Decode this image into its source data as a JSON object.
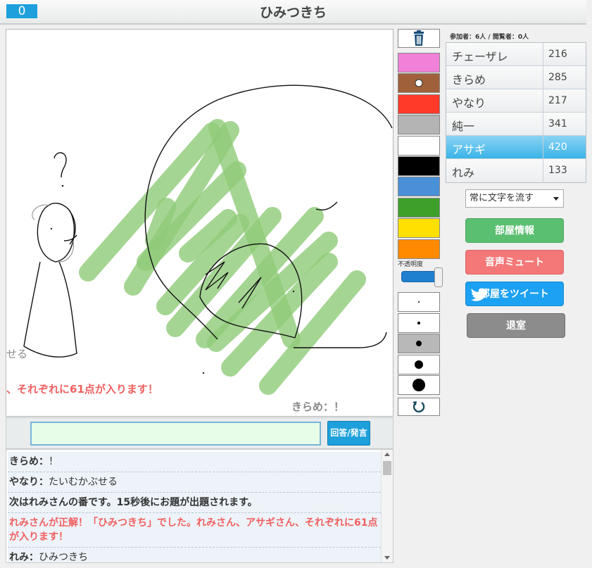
{
  "header": {
    "counter": "0",
    "title": "ひみつきち"
  },
  "canvas": {
    "partial_text_left": "せる",
    "partial_announcement": "、それぞれに61点が入ります！",
    "chat_bubble": "きらめ：！"
  },
  "answer": {
    "placeholder": "",
    "button_label": "回答/発言"
  },
  "chat": {
    "messages": [
      {
        "name": "きらめ",
        "sep": "：",
        "text": "！",
        "kind": "user"
      },
      {
        "name": "やなり",
        "sep": "：",
        "text": "たいむかぶせる",
        "kind": "user"
      },
      {
        "text": "次はれみさんの番です。15秒後にお題が出題されます。",
        "kind": "system"
      },
      {
        "text": "れみさんが正解！「ひみつきち」でした。れみさん、アサギさん、それぞれに61点が入ります！",
        "kind": "correct"
      },
      {
        "name": "れみ",
        "sep": "：",
        "text": "ひみつきち",
        "kind": "user"
      }
    ]
  },
  "tools": {
    "colors": [
      "#f080d8",
      "#a0603a",
      "#ff3a28",
      "#b4b4b4",
      "#ffffff",
      "#000000",
      "#4a90d8",
      "#3ea02a",
      "#ffe000",
      "#ff8a00"
    ],
    "selected_color_index": 1,
    "opacity_label": "不透明度",
    "opacity_value": 1.0,
    "brush_sizes": [
      2,
      4,
      8,
      12,
      18
    ],
    "selected_size_index": 2,
    "icons": {
      "trash": "trash-icon",
      "undo": "undo-icon"
    }
  },
  "room": {
    "participants": "参加者：6人 / 閲覧者：0人",
    "players": [
      {
        "name": "チェーザレ",
        "score": "216",
        "active": false
      },
      {
        "name": "きらめ",
        "score": "285",
        "active": false
      },
      {
        "name": "やなり",
        "score": "217",
        "active": false
      },
      {
        "name": "純一",
        "score": "341",
        "active": false
      },
      {
        "name": "アサギ",
        "score": "420",
        "active": true
      },
      {
        "name": "れみ",
        "score": "133",
        "active": false
      }
    ],
    "flow_select": "常に文字を流す",
    "buttons": {
      "info": "部屋情報",
      "mute": "音声ミュート",
      "tweet": "部屋をツイート",
      "exit": "退室"
    },
    "colors": {
      "info": "#5bbf71",
      "mute": "#f47878",
      "tweet": "#1da1f2",
      "exit": "#8c8c8c",
      "active_row": "#3ab4e8"
    }
  }
}
